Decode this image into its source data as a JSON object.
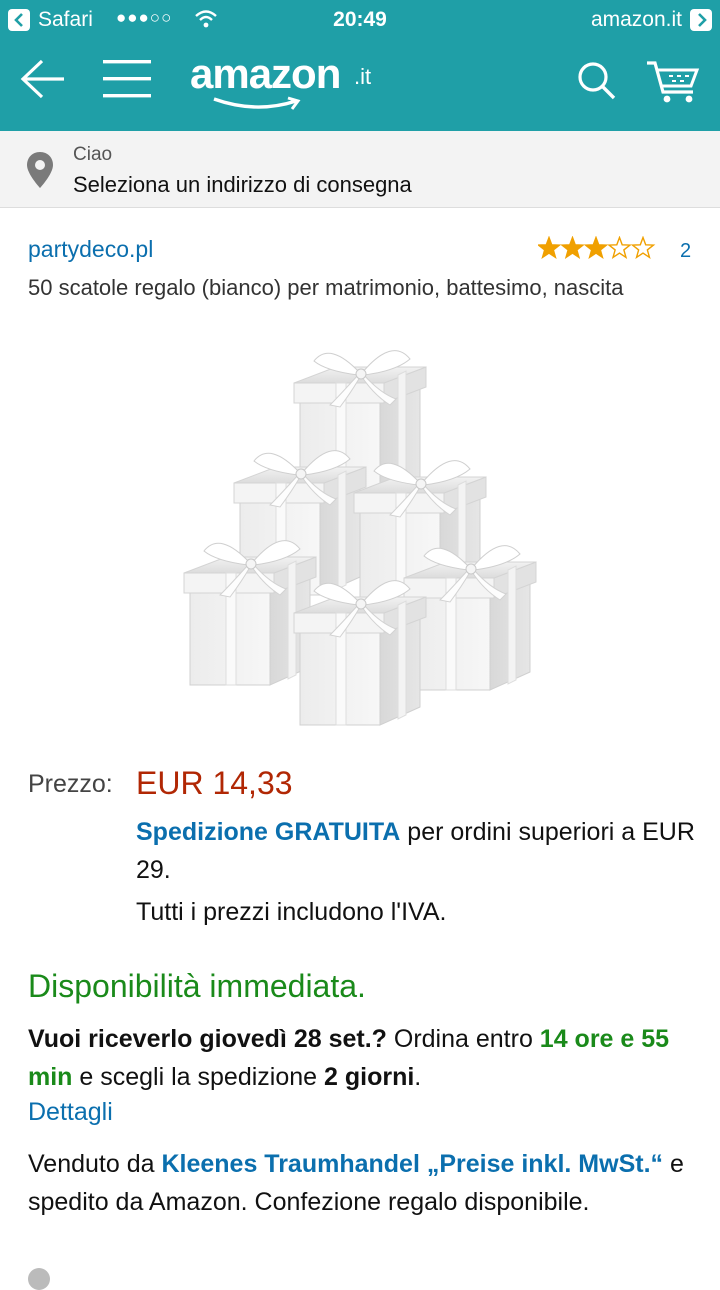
{
  "status_bar": {
    "app": "Safari",
    "signal": "●●●○○",
    "time": "20:49",
    "site": "amazon.it"
  },
  "navbar": {
    "logo_word": "amazon",
    "logo_suffix": ".it",
    "brand_color": "#1f9fa7"
  },
  "address": {
    "greeting": "Ciao",
    "prompt": "Seleziona un indirizzo di consegna"
  },
  "product": {
    "brand": "partydeco.pl",
    "rating": 3,
    "rating_max": 5,
    "review_count": "2",
    "title": "50 scatole regalo (bianco) per matrimonio, battesimo, nascita"
  },
  "price": {
    "label": "Prezzo:",
    "value": "EUR 14,33",
    "shipping_highlight": "Spedizione GRATUITA",
    "shipping_rest": " per ordini superiori a EUR 29.",
    "vat_note": "Tutti i prezzi includono l'IVA."
  },
  "availability": {
    "status": "Disponibilità immediata.",
    "delivery_question": "Vuoi riceverlo giovedì 28 set.?",
    "order_within": " Ordina entro ",
    "countdown": "14 ore e 55 min",
    "choose": " e scegli la spedizione ",
    "shipping_option": "2 giorni",
    "period": ".",
    "details_link": "Dettagli"
  },
  "seller": {
    "sold_by": "Venduto da ",
    "seller_name": "Kleenes Traumhandel „Preise inkl. MwSt.“",
    "rest": " e spedito da Amazon. Confezione regalo disponibile."
  },
  "colors": {
    "link": "#0b6fae",
    "price": "#b12704",
    "in_stock": "#1a8a1a",
    "star": "#f0a000"
  }
}
